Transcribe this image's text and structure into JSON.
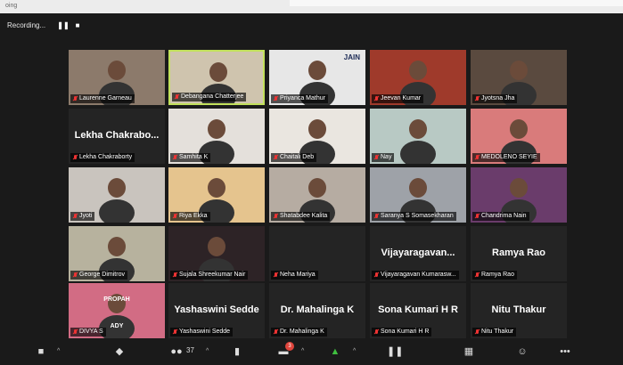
{
  "window": {
    "title": "oing"
  },
  "recording": {
    "label": "Recording...",
    "pause_icon": "pause-icon",
    "stop_icon": "stop-icon"
  },
  "participants": [
    {
      "name": "Laurenne Garneau",
      "video": true,
      "tone": "#8c7a6b"
    },
    {
      "name": "Debangana Chatterjee",
      "video": true,
      "tone": "#cfc4ae",
      "active": true
    },
    {
      "name": "Priyanca Mathur",
      "video": true,
      "tone": "#e7e7e7",
      "logo": "JAIN"
    },
    {
      "name": "Jeevan Kumar",
      "video": true,
      "tone": "#9f3a2b"
    },
    {
      "name": "Jyotsna Jha",
      "video": true,
      "tone": "#5a4a3f"
    },
    {
      "name": "Lekha Chakraborty",
      "video": false,
      "display": "Lekha  Chakrabo..."
    },
    {
      "name": "Samhita K",
      "video": true,
      "tone": "#e4e0db"
    },
    {
      "name": "Chaitali Deb",
      "video": true,
      "tone": "#eae6e0"
    },
    {
      "name": "Nay",
      "video": true,
      "tone": "#b8c9c4"
    },
    {
      "name": "MEDOLENO SEYIE",
      "video": true,
      "tone": "#d97b7b"
    },
    {
      "name": "Jyoti",
      "video": true,
      "tone": "#c9c4be"
    },
    {
      "name": "Riya Ekka",
      "video": true,
      "tone": "#e5c48e"
    },
    {
      "name": "Shatabdee Kalita",
      "video": true,
      "tone": "#b6aca2"
    },
    {
      "name": "Saranya S Somasekharan",
      "video": true,
      "tone": "#9ea2a8"
    },
    {
      "name": "Chandrima Nain",
      "video": true,
      "tone": "#6a3c6b"
    },
    {
      "name": "George Dimitrov",
      "video": true,
      "tone": "#b7b29e"
    },
    {
      "name": "Sujala Shreekumar Nair",
      "video": true,
      "tone": "#2d2326"
    },
    {
      "name": "Neha Mariya",
      "video": false,
      "display": ""
    },
    {
      "name": "Vijayaragavan Kumaraswamy",
      "video": false,
      "display": "Vijayaragavan...",
      "label": "Vijayaragavan Kumarasw..."
    },
    {
      "name": "Ramya Rao",
      "video": false,
      "display": "Ramya Rao"
    },
    {
      "name": "DIVYA S",
      "video": true,
      "tone": "#d26c84",
      "poster": "PROPAH ADY"
    },
    {
      "name": "Yashaswini Sedde",
      "video": false,
      "display": "Yashaswini Sedde"
    },
    {
      "name": "Dr. Mahalinga K",
      "video": false,
      "display": "Dr. Mahalinga K"
    },
    {
      "name": "Sona Kumari H R",
      "video": false,
      "display": "Sona Kumari H R"
    },
    {
      "name": "Nitu Thakur",
      "video": false,
      "display": "Nitu Thakur"
    }
  ],
  "toolbar": {
    "participants_count": "37",
    "chat_badge": "3"
  }
}
